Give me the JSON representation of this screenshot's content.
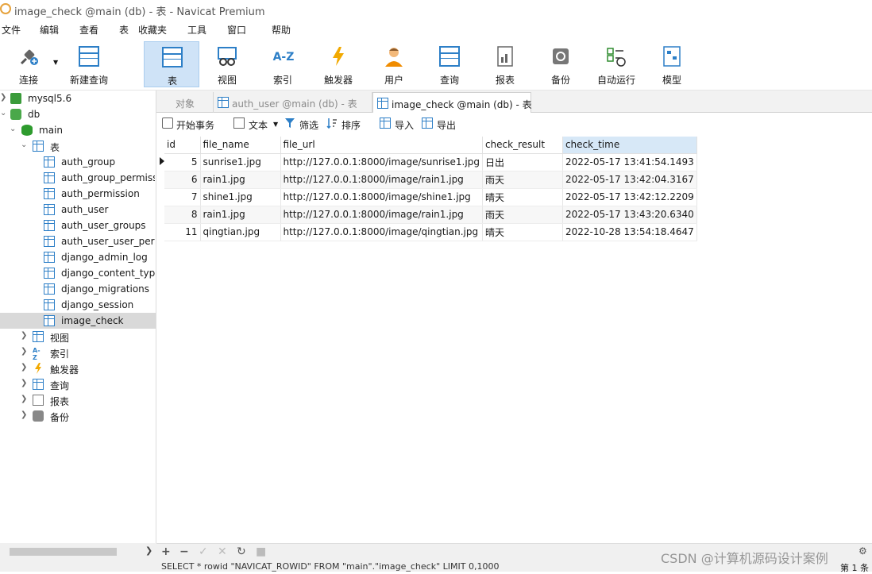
{
  "window": {
    "title": "image_check @main (db) - 表 - Navicat Premium"
  },
  "menu": [
    "文件",
    "编辑",
    "查看",
    "表",
    "收藏夹",
    "工具",
    "窗口",
    "帮助"
  ],
  "toolbar": {
    "connect": "连接",
    "new_query": "新建查询",
    "buttons": [
      "表",
      "视图",
      "索引",
      "触发器",
      "用户",
      "查询",
      "报表",
      "备份",
      "自动运行",
      "模型"
    ],
    "index_glyph": "A-Z"
  },
  "sidebar": {
    "connection": "mysql5.6",
    "db": "db",
    "schema": "main",
    "tables_group": "表",
    "tables": [
      "auth_group",
      "auth_group_permiss",
      "auth_permission",
      "auth_user",
      "auth_user_groups",
      "auth_user_user_perm",
      "django_admin_log",
      "django_content_type",
      "django_migrations",
      "django_session",
      "image_check"
    ],
    "groups": [
      "视图",
      "索引",
      "触发器",
      "查询",
      "报表",
      "备份"
    ]
  },
  "tabs": [
    "对象",
    "auth_user @main (db) - 表",
    "image_check @main (db) - 表"
  ],
  "subtoolbar": {
    "begin_transaction": "开始事务",
    "text": "文本",
    "filter": "筛选",
    "sort": "排序",
    "import": "导入",
    "export": "导出"
  },
  "grid": {
    "columns": [
      "id",
      "file_name",
      "file_url",
      "check_result",
      "check_time"
    ],
    "rows": [
      [
        "5",
        "sunrise1.jpg",
        "http://127.0.0.1:8000/image/sunrise1.jpg",
        "日出",
        "2022-05-17 13:41:54.1493"
      ],
      [
        "6",
        "rain1.jpg",
        "http://127.0.0.1:8000/image/rain1.jpg",
        "雨天",
        "2022-05-17 13:42:04.3167"
      ],
      [
        "7",
        "shine1.jpg",
        "http://127.0.0.1:8000/image/shine1.jpg",
        "晴天",
        "2022-05-17 13:42:12.2209"
      ],
      [
        "8",
        "rain1.jpg",
        "http://127.0.0.1:8000/image/rain1.jpg",
        "雨天",
        "2022-05-17 13:43:20.6340"
      ],
      [
        "11",
        "qingtian.jpg",
        "http://127.0.0.1:8000/image/qingtian.jpg",
        "晴天",
        "2022-10-28 13:54:18.4647"
      ]
    ]
  },
  "status": {
    "sql": "SELECT * rowid \"NAVICAT_ROWID\" FROM \"main\".\"image_check\" LIMIT 0,1000",
    "count": "第 1 条"
  },
  "watermark": "CSDN @计算机源码设计案例",
  "colors": {
    "accent": "#2d7fc7",
    "active_tab": "#cfe3f7",
    "selection": "#d9d9d9"
  }
}
